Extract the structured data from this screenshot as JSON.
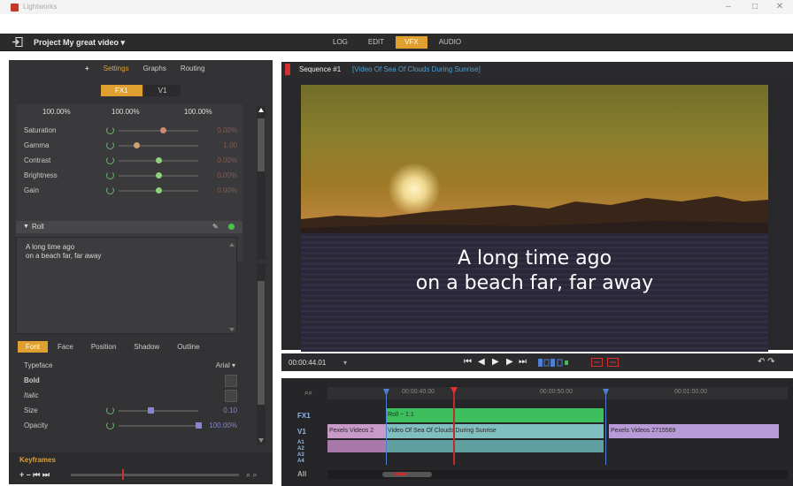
{
  "app": {
    "title": "Lightworks"
  },
  "header": {
    "project_name": "Project My great video ▾",
    "modes": [
      {
        "label": "LOG",
        "active": false
      },
      {
        "label": "EDIT",
        "active": false
      },
      {
        "label": "VFX",
        "active": true
      },
      {
        "label": "AUDIO",
        "active": false
      }
    ]
  },
  "left_panel": {
    "add_symbol": "+",
    "tabs": [
      {
        "label": "Settings",
        "active": true
      },
      {
        "label": "Graphs",
        "active": false
      },
      {
        "label": "Routing",
        "active": false
      }
    ],
    "fx_tabs": [
      {
        "label": "FX1",
        "active": true
      },
      {
        "label": "V1",
        "active": false
      }
    ],
    "percentages": [
      "100.00%",
      "100.00%",
      "100.00%"
    ],
    "color_rows": [
      {
        "label": "Saturation",
        "value": "0.00%",
        "level": 0.55,
        "color": "#d08a70"
      },
      {
        "label": "Gamma",
        "value": "1.00",
        "level": 0.22,
        "color": "#d0a070"
      },
      {
        "label": "Contrast",
        "value": "0.00%",
        "level": 0.5,
        "color": "#8fd07a"
      },
      {
        "label": "Brightness",
        "value": "0.00%",
        "level": 0.5,
        "color": "#8fd07a"
      },
      {
        "label": "Gain",
        "value": "0.00%",
        "level": 0.5,
        "color": "#8fd07a"
      }
    ],
    "title_effect": {
      "name": "Roll",
      "text_lines": [
        "A long time ago",
        "on a beach far, far away"
      ]
    },
    "font_tabs": [
      {
        "label": "Font",
        "active": true
      },
      {
        "label": "Face",
        "active": false
      },
      {
        "label": "Position",
        "active": false
      },
      {
        "label": "Shadow",
        "active": false
      },
      {
        "label": "Outline",
        "active": false
      }
    ],
    "font": {
      "typeface_label": "Typeface",
      "typeface_value": "Arial ▾",
      "bold_label": "Bold",
      "italic_label": "Italic",
      "size_label": "Size",
      "size_value": "0.10",
      "size_level": 0.4,
      "opacity_label": "Opacity",
      "opacity_value": "100.00%",
      "opacity_level": 1.0
    },
    "keyframes": {
      "label": "Keyframes",
      "controls": "+ –  ⏮ ⏭"
    }
  },
  "viewer": {
    "sequence_label": "Sequence #1",
    "clip_name": "[Video Of Sea Of Clouds During Sunrise]",
    "overlay_lines": [
      "A long time ago",
      "on a beach far, far away"
    ],
    "timecode": "00:00:44.01",
    "timecode_dropdown": "▾"
  },
  "timeline": {
    "ruler_marks": [
      "00:00:40.00",
      "00:00:50.00",
      "00:01:00.00"
    ],
    "tracks": [
      {
        "label": "FX1"
      },
      {
        "label": "V1"
      }
    ],
    "audio_labels": [
      "A1",
      "A2",
      "A3",
      "A4"
    ],
    "bottom_label": "All",
    "clips": [
      {
        "track": "FX1",
        "label": "Roll ~ 1:1",
        "color": "#3cbf5c"
      },
      {
        "track": "V1",
        "label": "Pexels Videos 2",
        "color": "#c89ac8"
      },
      {
        "track": "V1",
        "label": "Video Of Sea Of Clouds During Sunrise",
        "color": "#7fbfbf"
      },
      {
        "track": "V1",
        "label": "Pexels Videos 2715569",
        "color": "#b89ad8"
      }
    ]
  }
}
